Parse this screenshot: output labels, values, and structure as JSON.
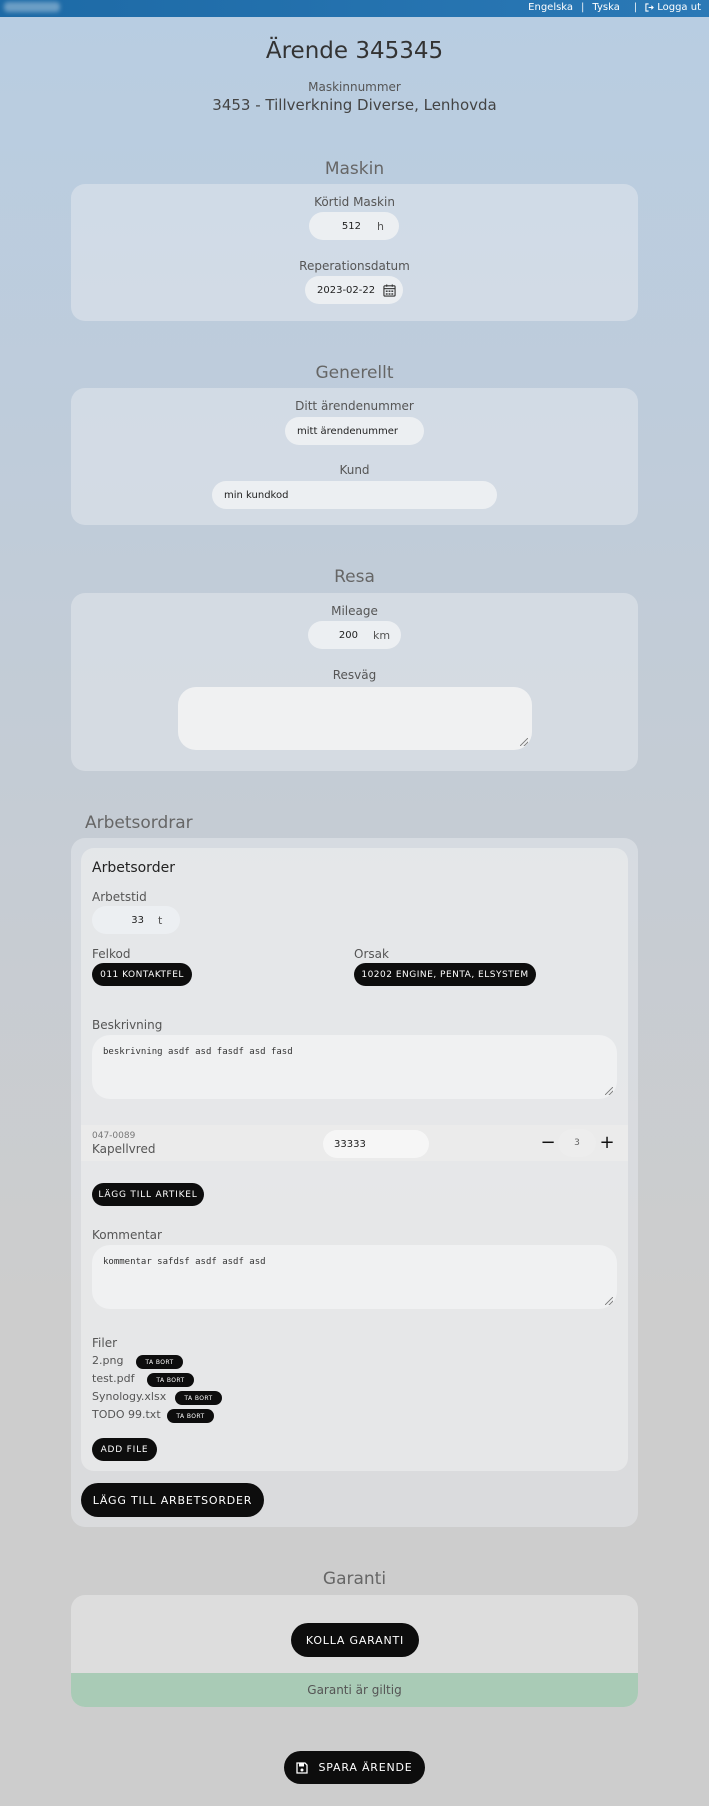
{
  "topbar": {
    "nav": [
      "Engelska",
      "Tyska"
    ],
    "logout_label": "Logga ut"
  },
  "header": {
    "title": "Ärende 345345",
    "machine_number_label": "Maskinnummer",
    "machine_number_value": "3453 - Tillverkning Diverse, Lenhovda"
  },
  "maskin": {
    "title": "Maskin",
    "runtime_label": "Körtid Maskin",
    "runtime_value": "512",
    "runtime_unit": "h",
    "repair_date_label": "Reperationsdatum",
    "repair_date_value": "2023-02-22"
  },
  "generellt": {
    "title": "Generellt",
    "case_number_label": "Ditt ärendenummer",
    "case_number_value": "mitt ärendenummer",
    "customer_label": "Kund",
    "customer_value": "min kundkod"
  },
  "resa": {
    "title": "Resa",
    "mileage_label": "Mileage",
    "mileage_value": "200",
    "mileage_unit": "km",
    "route_label": "Resväg",
    "route_value": ""
  },
  "arbetsordrar": {
    "title": "Arbetsordrar",
    "order": {
      "title": "Arbetsorder",
      "worktime_label": "Arbetstid",
      "worktime_value": "33",
      "worktime_unit": "t",
      "fault_code_label": "Felkod",
      "fault_code_value": "011 KONTAKTFEL",
      "cause_label": "Orsak",
      "cause_value": "10202 ENGINE, PENTA, ELSYSTEM",
      "description_label": "Beskrivning",
      "description_value": "beskrivning asdf asd fasdf asd fasd",
      "article": {
        "number": "047-0089",
        "name": "Kapellvred",
        "value": "33333",
        "quantity": "3"
      },
      "add_article_label": "LÄGG TILL ARTIKEL",
      "comment_label": "Kommentar",
      "comment_value": "kommentar safdsf asdf asdf asd",
      "files_label": "Filer",
      "files": [
        {
          "name": "2.png",
          "remove_label": "TA BORT"
        },
        {
          "name": "test.pdf",
          "remove_label": "TA BORT"
        },
        {
          "name": "Synology.xlsx",
          "remove_label": "TA BORT"
        },
        {
          "name": "TODO 99.txt",
          "remove_label": "TA BORT"
        }
      ],
      "add_file_label": "ADD FILE"
    },
    "add_order_label": "LÄGG TILL ARBETSORDER"
  },
  "garanti": {
    "title": "Garanti",
    "check_label": "KOLLA GARANTI",
    "status_text": "Garanti är giltig",
    "status_color": "#a9cbb6"
  },
  "save_label": "SPARA ÄRENDE"
}
